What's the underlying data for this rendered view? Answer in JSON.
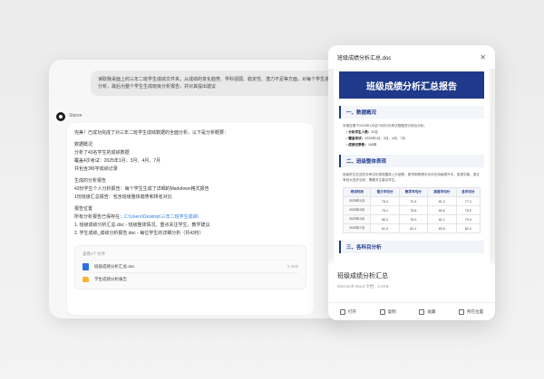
{
  "chat": {
    "user_message": "读取我桌面上的三年二班学生成绩文件夹，从成绩的变化趋势、学科强弱、稳定性、潜力不足等方面，对每个学生进行分析，最后为整个学生生成班级分析报告，并对其提出建议",
    "bot_name": "Starve",
    "intro": "完美！已成功完成了对三年二班学生成绩数据的全面分析。以下是分析概要：",
    "sections": [
      {
        "title": "数据概况",
        "lines": [
          "分析了43名学生的成绩数据",
          "覆盖4次考试：2025年1月、3月、4月、7月",
          "共包含3科学成绩记录"
        ]
      },
      {
        "title": "生成的分析报告",
        "lines": [
          "43份学生个人分析报告：每个学生生成了详细的Markdown格式报告",
          "1份班级汇总报告：包含班级整体趋势和排名对比"
        ]
      },
      {
        "title": "报告位置"
      }
    ],
    "location_prefix": "所有分析报告已保存在：",
    "location_path": "C:\\Users\\Desktop\\三年二班学生成绩\\",
    "location_items": [
      "1. 班级成绩分析汇总.doc - 班级整体情况、重点关注学生、教学建议",
      "2. 学生成绩_成绩分析报告.doc - 每位学生的详细分析（共43份）"
    ],
    "files_title": "查看4个文件",
    "files": [
      {
        "name": "班级成绩分析汇总.doc",
        "size": "2.4KB",
        "type": "doc"
      },
      {
        "name": "学生成绩分析报告",
        "size": "",
        "type": "folder"
      }
    ]
  },
  "preview": {
    "title": "班级成绩分析汇总.doc",
    "doc_banner": "班级成绩分析汇总报告",
    "section1": "一、数据概况",
    "section1_text": "本报告基于2025年1月至7月的4次考试数据进行综合分析。",
    "bullets": [
      {
        "k": "分析学生人数：",
        "v": "43名"
      },
      {
        "k": "覆盖考试：",
        "v": "2025年1月、3月、4月、7月"
      },
      {
        "k": "成绩记录数：",
        "v": "168条"
      }
    ],
    "section2": "二、班级整体表现",
    "section2_text": "班级学生在这些次考试中表现整体上升趋势，数学和物理平均分在持续提升中，英语平稳，语文有较大进步空间，需要关注重点学生。",
    "table": {
      "headers": [
        "考试时间",
        "语文平均分",
        "数学平均分",
        "英语平均分",
        "总平均分"
      ],
      "rows": [
        [
          "2025年1月",
          "78.3",
          "72.4",
          "81.2",
          "77.3"
        ],
        [
          "2025年3月",
          "79.1",
          "75.8",
          "80.6",
          "78.5"
        ],
        [
          "2025年4月",
          "80.2",
          "78.3",
          "81.1",
          "79.9"
        ],
        [
          "2025年7月",
          "81.5",
          "82.1",
          "83.5",
          "82.4"
        ]
      ]
    },
    "section3": "三、各科目分析",
    "file_title": "班级成绩分析汇总",
    "file_meta": "Microsoft Word 文档 · 2.4KB",
    "actions": [
      "打开",
      "复制",
      "收藏",
      "所在位置"
    ]
  }
}
